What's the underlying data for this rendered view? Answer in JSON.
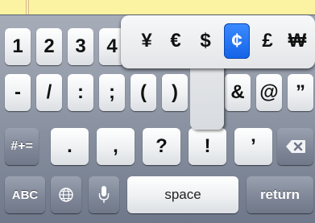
{
  "keyboard": {
    "row1": [
      "1",
      "2",
      "3",
      "4"
    ],
    "row2": [
      "-",
      "/",
      ":",
      ";",
      "(",
      ")",
      "&",
      "@",
      "”"
    ],
    "row3": {
      "more_symbols": "#+=",
      "keys": [
        ".",
        ",",
        "?",
        "!",
        "’"
      ]
    },
    "row4": {
      "abc": "ABC",
      "space": "space",
      "return": "return"
    },
    "icons": {
      "globe": "globe-icon",
      "microphone": "microphone-icon",
      "delete": "delete-icon"
    },
    "colors": {
      "selected_accent": "#1463e8",
      "notepad_paper": "#fbf3a2"
    }
  },
  "currency_popup": {
    "options": [
      "¥",
      "€",
      "$",
      "¢",
      "£",
      "₩"
    ],
    "selected": "¢"
  }
}
